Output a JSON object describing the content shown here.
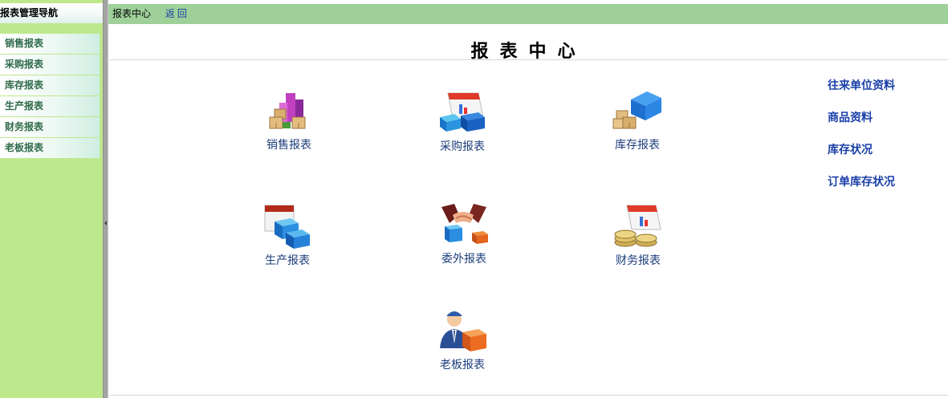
{
  "sidebar": {
    "title": "报表管理导航",
    "items": [
      {
        "label": "销售报表"
      },
      {
        "label": "采购报表"
      },
      {
        "label": "库存报表"
      },
      {
        "label": "生产报表"
      },
      {
        "label": "财务报表"
      },
      {
        "label": "老板报表"
      }
    ]
  },
  "topbar": {
    "title": "报表中心",
    "back_label": "返回"
  },
  "main": {
    "title": "报表中心",
    "reports": [
      {
        "label": "销售报表",
        "icon": "sales-boxes-chart-icon"
      },
      {
        "label": "采购报表",
        "icon": "purchase-calendar-boxes-icon"
      },
      {
        "label": "库存报表",
        "icon": "inventory-warehouse-icon"
      },
      {
        "label": "生产报表",
        "icon": "production-calendar-boxes-icon"
      },
      {
        "label": "委外报表",
        "icon": "outsourcing-handshake-icon"
      },
      {
        "label": "财务报表",
        "icon": "finance-coins-calendar-icon"
      },
      {
        "label": "老板报表",
        "icon": "boss-person-box-icon"
      }
    ],
    "quick_links": [
      {
        "label": "往来单位资料"
      },
      {
        "label": "商品资料"
      },
      {
        "label": "库存状况"
      },
      {
        "label": "订单库存状况"
      }
    ]
  },
  "colors": {
    "sidebar_bg": "#bee88c",
    "topbar_bg": "#9fd09a",
    "link": "#1a3fa8",
    "report_label": "#1c3d7a"
  }
}
